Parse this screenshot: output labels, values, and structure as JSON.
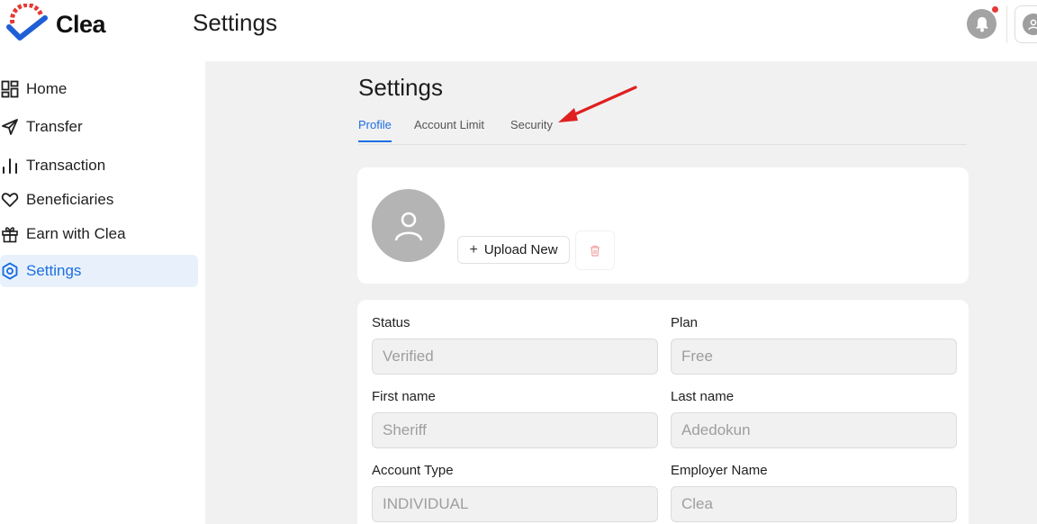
{
  "app": {
    "brand_name": "Clea",
    "page_title": "Settings"
  },
  "header": {
    "notification_has_alert": true
  },
  "sidebar": {
    "items": [
      {
        "label": "Home",
        "icon": "grid-icon",
        "active": false
      },
      {
        "label": "Transfer",
        "icon": "send-icon",
        "active": false
      },
      {
        "label": "Transaction",
        "icon": "bar-chart-icon",
        "active": false
      },
      {
        "label": "Beneficiaries",
        "icon": "heart-icon",
        "active": false
      },
      {
        "label": "Earn with Clea",
        "icon": "gift-icon",
        "active": false
      },
      {
        "label": "Settings",
        "icon": "settings-hex-icon",
        "active": true
      }
    ]
  },
  "main": {
    "title": "Settings",
    "tabs": [
      {
        "label": "Profile",
        "active": true
      },
      {
        "label": "Account Limit",
        "active": false
      },
      {
        "label": "Security",
        "active": false
      }
    ],
    "profile_card": {
      "upload_label": "Upload New"
    },
    "fields": {
      "status": {
        "label": "Status",
        "value": "Verified"
      },
      "plan": {
        "label": "Plan",
        "value": "Free"
      },
      "first_name": {
        "label": "First name",
        "value": "Sheriff"
      },
      "last_name": {
        "label": "Last name",
        "value": "Adedokun"
      },
      "account_type": {
        "label": "Account Type",
        "value": "INDIVIDUAL"
      },
      "employer_name": {
        "label": "Employer Name",
        "value": "Clea"
      }
    }
  },
  "colors": {
    "accent": "#1c6fe0",
    "active_nav_bg": "#e8f1fb",
    "alert_red": "#e53935",
    "logo_blue": "#1f5fd6",
    "logo_red": "#e53935"
  }
}
